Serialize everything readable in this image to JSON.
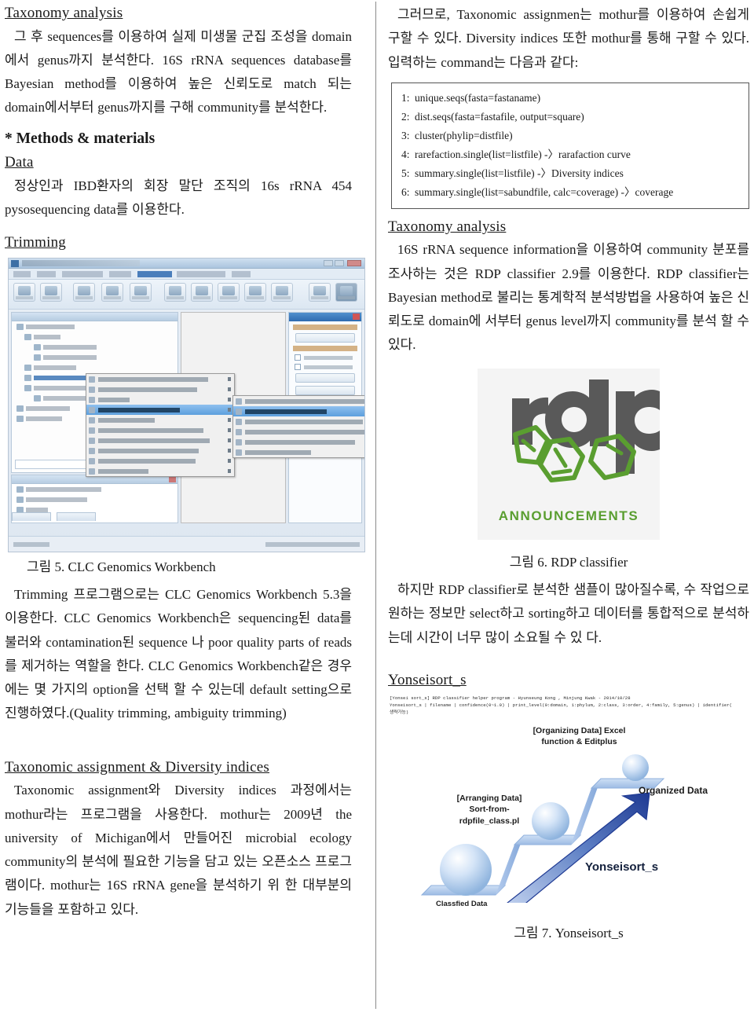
{
  "left_column": {
    "section1": {
      "heading": "Taxonomy analysis",
      "paragraph": "그 후 sequences를 이용하여 실제 미생물 군집 조성을 domain에서 genus까지 분석한다. 16S rRNA sequences database를 Bayesian method를 이용하여 높은 신뢰도로 match 되는 domain에서부터 genus까지를 구해 community를 분석한다."
    },
    "section2": {
      "heading": "* Methods & materials",
      "subheading": "Data",
      "paragraph": "정상인과 IBD환자의 회장 말단 조직의 16s rRNA 454 pysosequencing data를 이용한다."
    },
    "section3": {
      "heading": "Trimming",
      "figure_caption": "그림 5. CLC Genomics Workbench",
      "paragraph": "Trimming 프로그램으로는 CLC Genomics Workbench 5.3을 이용한다. CLC Genomics Workbench은 sequencing된 data를 불러와 contamination된 sequence 나 poor quality parts of reads를 제거하는 역할을 한다. CLC Genomics Workbench같은 경우에는 몇 가지의 option을 선택 할 수 있는데 default setting으로 진행하였다.(Quality trimming, ambiguity trimming)"
    },
    "section4": {
      "heading": "Taxonomic assignment & Diversity indices",
      "paragraph": "Taxonomic assignment와 Diversity indices 과정에서는 mothur라는 프로그램을 사용한다. mothur는 2009년 the university of Michigan에서 만들어진 microbial ecology community의 분석에 필요한 기능을 담고 있는 오픈소스 프로그램이다. mothur는 16S rRNA gene을 분석하기 위 한 대부분의 기능들을 포함하고 있다."
    }
  },
  "right_column": {
    "intro_paragraph": "그러므로, Taxonomic assignmen는 mothur를 이용하여 손쉽게 구할 수 있다. Diversity indices 또한 mothur를 통해 구할 수 있다. 입력하는 command는 다음과 같다:",
    "commands": [
      {
        "num": "1:",
        "text": "unique.seqs(fasta=fastaname)"
      },
      {
        "num": "2:",
        "text": "dist.seqs(fasta=fastafile, output=square)"
      },
      {
        "num": "3:",
        "text": "cluster(phylip=distfile)"
      },
      {
        "num": "4:",
        "text": "rarefaction.single(list=listfile) -〉rarafaction curve"
      },
      {
        "num": "5:",
        "text": "summary.single(list=listfile) -〉Diversity indices"
      },
      {
        "num": "6:",
        "text": "summary.single(list=sabundfile, calc=coverage) -〉coverage"
      }
    ],
    "section_taxonomy": {
      "heading": "Taxonomy analysis",
      "paragraph": "16S rRNA sequence information을 이용하여 community 분포를 조사하는 것은 RDP classifier 2.9를 이용한다. RDP classifier는 Bayesian method로 불리는 통계학적 분석방법을 사용하여 높은 신뢰도로 domain에 서부터 genus level까지 community를 분석 할 수 있다."
    },
    "rdp_logo": {
      "wordmark": "rdp",
      "caption": "ANNOUNCEMENTS",
      "wordmark_color": "#595959",
      "accent_color": "#5a9e30",
      "background_color": "#f4f4f4"
    },
    "figure6_caption": "그림 6. RDP classifier",
    "paragraph_after_fig6": "하지만 RDP classifier로 분석한 샘플이 많아질수록, 수 작업으로 원하는 정보만 select하고 sorting하고 데이터를 통합적으로 분석하는데 시간이 너무 많이 소요될 수 있 다.",
    "section_yonseisort": {
      "heading": "Yonseisort_s",
      "mono_line1": "[Yonsei sort_s] RDP classifier helper program - Hyunseung Kong , Minjung Kwak - 2014/10/28",
      "mono_line2": "Yonseisort_s | filename | confidence(0~1.0) | print_level(0:domain, 1:phylum, 2:class, 3:order, 4:family, 5:genus) | identifier(",
      "mono_line3": "생략가능)"
    },
    "figure7": {
      "label_step2": "[Organizing Data] Excel\nfunction & Editplus",
      "label_step1": "[Arranging Data]\nSort-from-\nrdpfile_class.pl",
      "label_top": "Organized Data",
      "label_bottom": "Classfied Data",
      "label_arrow": "Yonseisort_s",
      "caption": "그림 7. Yonseisort_s",
      "arrow_color": "#1f3a93",
      "step_color": "#aac4e8",
      "sphere_color": "#bcd2ee"
    }
  }
}
